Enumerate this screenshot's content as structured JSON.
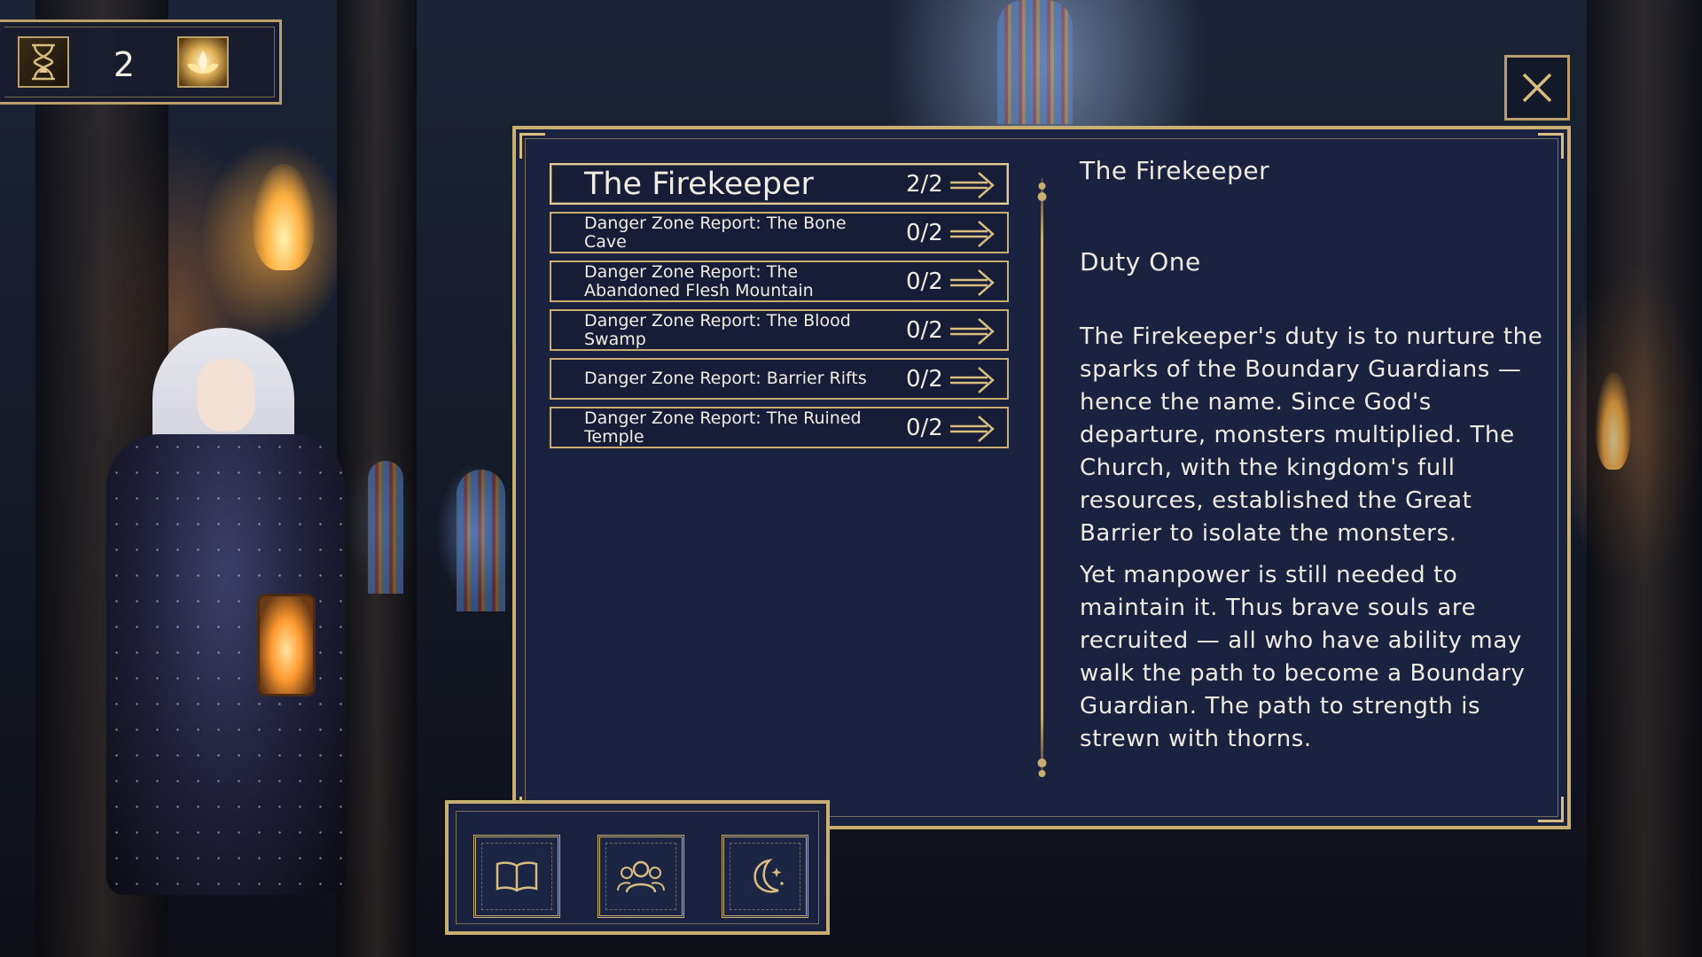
{
  "top_counter": {
    "value": "2",
    "left_icon": "hourglass-icon",
    "right_icon": "lotus-icon"
  },
  "close_button": {
    "icon": "close-icon"
  },
  "quest_list": [
    {
      "title": "The Firekeeper",
      "progress": "2/2",
      "active": true
    },
    {
      "title": "Danger Zone Report: The Bone Cave",
      "progress": "0/2",
      "active": false
    },
    {
      "title": "Danger Zone Report: The Abandoned Flesh Mountain",
      "progress": "0/2",
      "active": false
    },
    {
      "title": "Danger Zone Report: The Blood Swamp",
      "progress": "0/2",
      "active": false
    },
    {
      "title": "Danger Zone Report: Barrier Rifts",
      "progress": "0/2",
      "active": false
    },
    {
      "title": "Danger Zone Report: The Ruined Temple",
      "progress": "0/2",
      "active": false
    }
  ],
  "detail": {
    "title": "The Firekeeper",
    "subtitle": "Duty One",
    "paragraphs": [
      "The Firekeeper's duty is to nurture the sparks of the Boundary Guardians — hence the name. Since God's departure, monsters multiplied. The Church, with the kingdom's full resources, established the Great Barrier to isolate the monsters.",
      "Yet manpower is still needed to maintain it. Thus brave souls are recruited — all who have ability may walk the path to become a Boundary Guardian. The path to strength is strewn with thorns."
    ]
  },
  "tabs": [
    {
      "icon": "book-icon"
    },
    {
      "icon": "people-icon"
    },
    {
      "icon": "moon-icon"
    }
  ],
  "colors": {
    "gold": "#c9ae72",
    "panel": "#1b2240",
    "text": "#f1ede3"
  }
}
